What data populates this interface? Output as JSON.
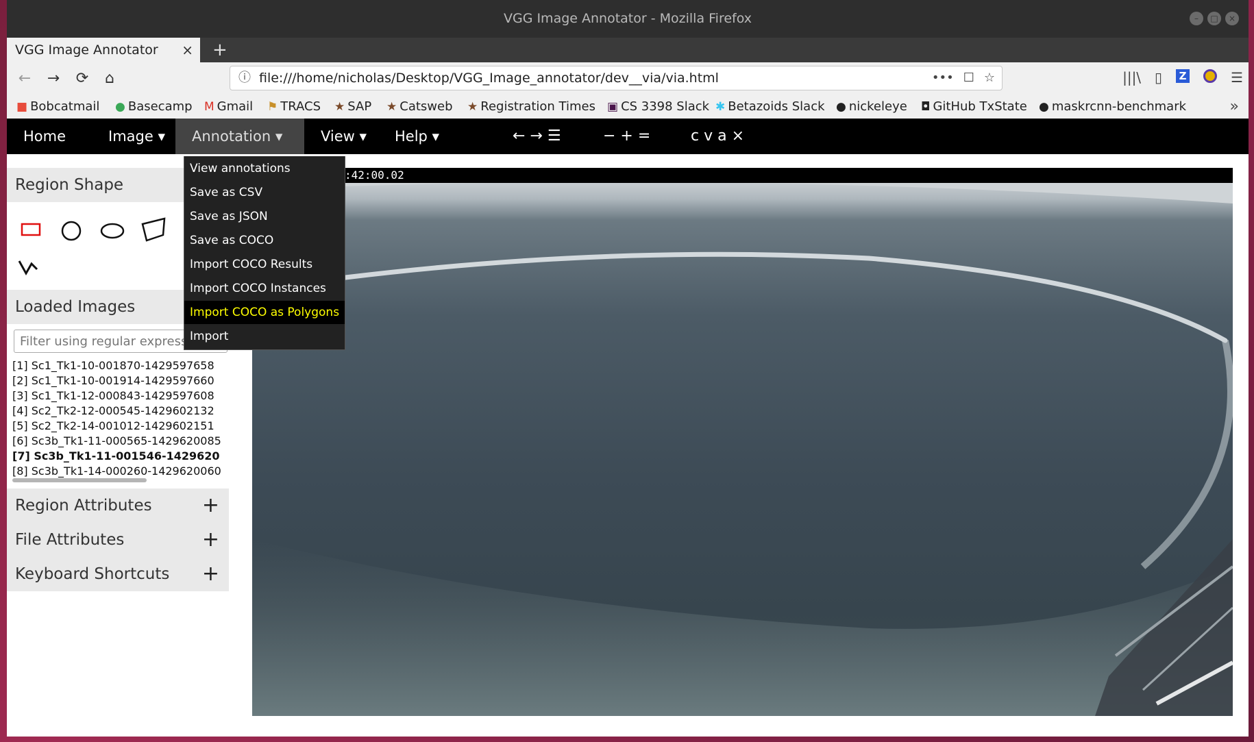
{
  "window": {
    "title": "VGG Image Annotator - Mozilla Firefox",
    "controls": [
      "–",
      "□",
      "×"
    ]
  },
  "tab": {
    "label": "VGG Image Annotator",
    "close": "×",
    "new_tab": "+"
  },
  "nav": {
    "back": "←",
    "forward": "→",
    "reload": "⟳",
    "home": "⌂",
    "url": "file:///home/nicholas/Desktop/VGG_Image_annotator/dev__via/via.html",
    "url_info_icon": "ⓘ",
    "url_actions": [
      "•••",
      "☐",
      "☆"
    ],
    "right_icons": [
      "|||\\",
      "▯",
      "Z",
      "",
      "☰"
    ]
  },
  "bookmarks": [
    {
      "icon": "■",
      "label": "Bobcatmail",
      "color": "#e74c3c"
    },
    {
      "icon": "●",
      "label": "Basecamp",
      "color": "#3aa857"
    },
    {
      "icon": "M",
      "label": "Gmail",
      "color": "#d93025"
    },
    {
      "icon": "⚑",
      "label": "TRACS",
      "color": "#c8902a"
    },
    {
      "icon": "★",
      "label": "SAP",
      "color": "#7a4a2a"
    },
    {
      "icon": "★",
      "label": "Catsweb",
      "color": "#7a4a2a"
    },
    {
      "icon": "★",
      "label": "Registration Times",
      "color": "#7a4a2a"
    },
    {
      "icon": "▣",
      "label": "CS 3398 Slack",
      "color": "#4a154b"
    },
    {
      "icon": "✱",
      "label": "Betazoids Slack",
      "color": "#36c5f0"
    },
    {
      "icon": "●",
      "label": "nickeleye",
      "color": "#111111"
    },
    {
      "icon": "◘",
      "label": "GitHub TxState",
      "color": "#111111"
    },
    {
      "icon": "●",
      "label": "maskrcnn-benchmark",
      "color": "#111111"
    }
  ],
  "bookmarks_more": "»",
  "via_menu": {
    "items": [
      "Home",
      "Image ▾",
      "Annotation ▾",
      "View ▾",
      "Help ▾"
    ],
    "nav_tools": "← → ☰",
    "zoom_tools": "− + =",
    "edit_tools": "c v a ×"
  },
  "dropdown": {
    "items": [
      "View annotations",
      "Save as CSV",
      "Save as JSON",
      "Save as COCO",
      "Import COCO Results",
      "Import COCO Instances",
      "Import COCO as Polygons",
      "Import"
    ],
    "highlighted": "Import COCO as Polygons"
  },
  "left_panel": {
    "region_shape": "Region Shape",
    "loaded_images": "Loaded Images",
    "filter_placeholder": "Filter using regular expression",
    "images": [
      "[1] Sc1_Tk1-10-001870-1429597658",
      "[2] Sc1_Tk1-10-001914-1429597660",
      "[3] Sc1_Tk1-12-000843-1429597608",
      "[4] Sc2_Tk2-12-000545-1429602132",
      "[5] Sc2_Tk2-14-001012-1429602151",
      "[6] Sc3b_Tk1-11-000565-1429620085",
      "[7] Sc3b_Tk1-11-001546-1429620",
      "[8] Sc3b_Tk1-14-000260-1429620060"
    ],
    "selected_index": 6,
    "region_attributes": "Region Attributes",
    "file_attributes": "File Attributes",
    "keyboard_shortcuts": "Keyboard Shortcuts",
    "plus": "+"
  },
  "image": {
    "timestamp": ":42:00.02"
  }
}
